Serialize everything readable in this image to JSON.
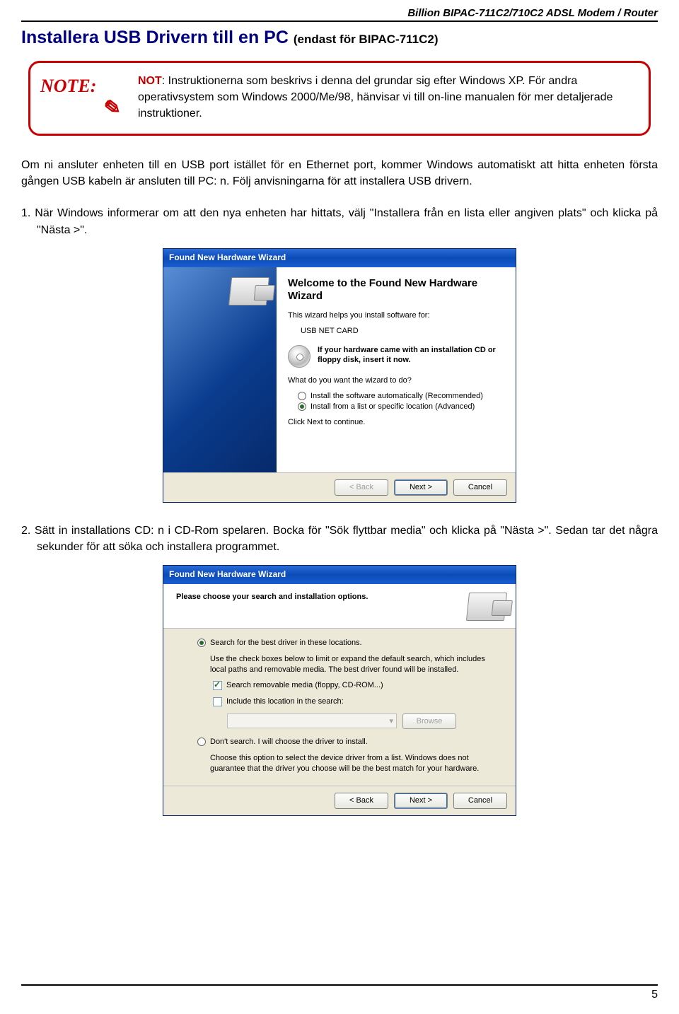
{
  "header": "Billion BIPAC-711C2/710C2 ADSL Modem / Router",
  "title": "Installera USB Drivern till en PC",
  "title_sub": "(endast för BIPAC-711C2)",
  "note": {
    "icon_text": "NOTE:",
    "label": "NOT",
    "text": ": Instruktionerna som beskrivs i denna del grundar sig efter Windows XP. För andra operativsystem som Windows 2000/Me/98, hänvisar vi till on-line manualen för mer detaljerade instruktioner."
  },
  "para1": "Om ni ansluter enheten till en USB port istället för en Ethernet port, kommer Windows automatiskt att hitta enheten första gången USB kabeln är ansluten till PC: n. Följ anvisningarna för att installera USB drivern.",
  "step1_num": "1.",
  "step1": "När Windows informerar om att den nya enheten har hittats, välj \"Installera från en lista eller angiven plats\" och klicka på \"Nästa >\".",
  "wizard1": {
    "titlebar": "Found New Hardware Wizard",
    "welcome": "Welcome to the Found New Hardware Wizard",
    "helps": "This wizard helps you install software for:",
    "device": "USB NET CARD",
    "cd_text": "If your hardware came with an installation CD or floppy disk, insert it now.",
    "question": "What do you want the wizard to do?",
    "opt1": "Install the software automatically (Recommended)",
    "opt2": "Install from a list or specific location (Advanced)",
    "cont": "Click Next to continue.",
    "back": "< Back",
    "next": "Next >",
    "cancel": "Cancel"
  },
  "step2_num": "2.",
  "step2": "Sätt in installations CD: n i CD-Rom spelaren. Bocka för \"Sök flyttbar media\" och klicka på \"Nästa >\". Sedan tar det några sekunder för att söka och installera programmet.",
  "wizard2": {
    "titlebar": "Found New Hardware Wizard",
    "head": "Please choose your search and installation options.",
    "r1": "Search for the best driver in these locations.",
    "r1_desc": "Use the check boxes below to limit or expand the default search, which includes local paths and removable media. The best driver found will be installed.",
    "cb1": "Search removable media (floppy, CD-ROM...)",
    "cb2": "Include this location in the search:",
    "browse": "Browse",
    "dropdown_arrow": "▾",
    "r2": "Don't search. I will choose the driver to install.",
    "r2_desc": "Choose this option to select the device driver from a list.  Windows does not guarantee that the driver you choose will be the best match for your hardware.",
    "back": "< Back",
    "next": "Next >",
    "cancel": "Cancel"
  },
  "page_number": "5"
}
